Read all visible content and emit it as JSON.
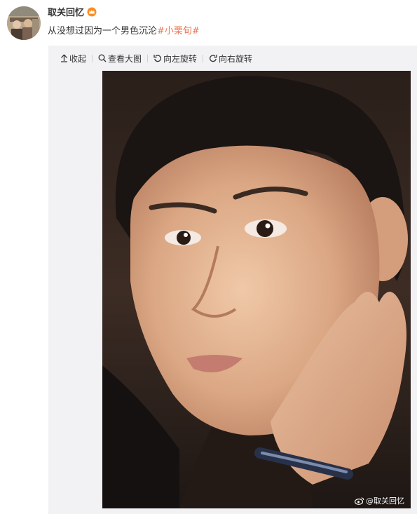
{
  "user": {
    "name": "取关回忆"
  },
  "post": {
    "text_prefix": "从没想过因为一个男色沉沦",
    "hashtag": "#小栗旬#"
  },
  "toolbar": {
    "collapse_label": "收起",
    "view_large_label": "查看大图",
    "rotate_left_label": "向左旋转",
    "rotate_right_label": "向右旋转"
  },
  "image": {
    "watermark": "@取关回忆"
  },
  "colors": {
    "hashtag": "#eb7350",
    "media_background": "#f2f2f5",
    "text": "#333333"
  },
  "icons": [
    "avatar",
    "crown-badge-icon",
    "collapse-icon",
    "search-icon",
    "rotate-left-icon",
    "rotate-right-icon",
    "weibo-icon"
  ]
}
